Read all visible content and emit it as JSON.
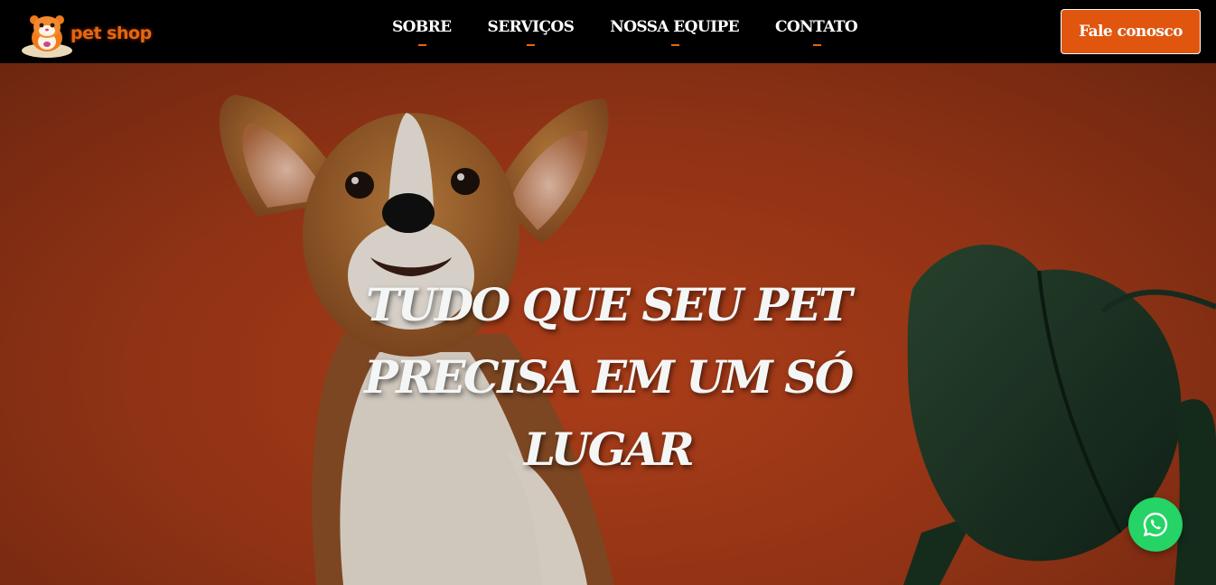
{
  "header": {
    "logo_text": "pet shop",
    "logo_icon": "hamster-mascot-icon",
    "nav": [
      {
        "label": "SOBRE"
      },
      {
        "label": "SERVIÇOS"
      },
      {
        "label": "NOSSA EQUIPE"
      },
      {
        "label": "CONTATO"
      }
    ],
    "cta_label": "Fale conosco"
  },
  "hero": {
    "title": "TUDO QUE SEU PET PRECISA EM UM SÓ LUGAR",
    "image": "corgi-puppy-with-plant-photo"
  },
  "floating": {
    "whatsapp_icon": "whatsapp-icon"
  },
  "colors": {
    "accent": "#e0560f",
    "navbar_bg": "#000000",
    "hero_bg": "#b3401b",
    "whatsapp": "#25d366"
  }
}
